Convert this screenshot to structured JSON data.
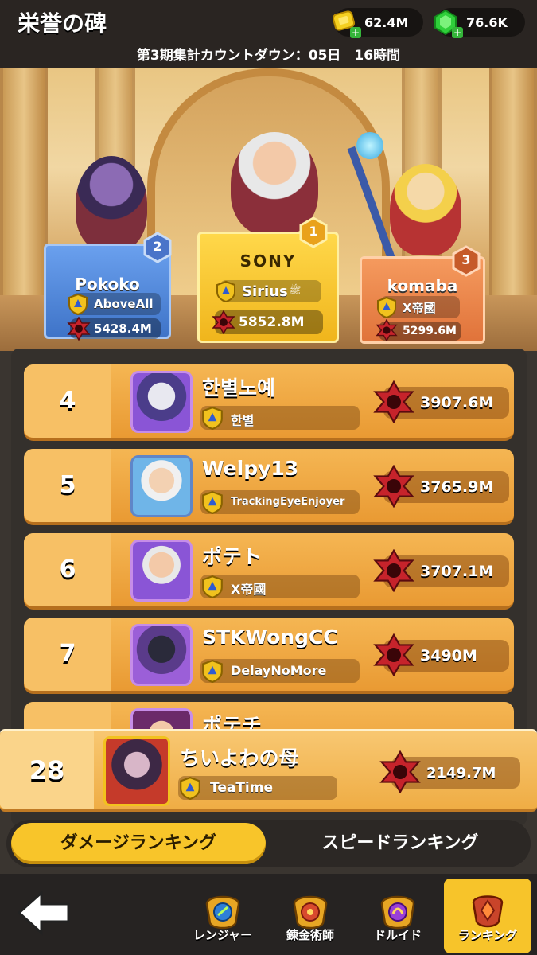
{
  "header": {
    "title": "栄誉の碑",
    "gold": "62.4M",
    "gems": "76.6K"
  },
  "countdown": "第3期集計カウントダウン：05日　16時間",
  "podium": [
    {
      "rank": "2",
      "name": "Pokoko",
      "guild": "AboveAll",
      "damage": "5428.4M",
      "color": "#5b8fe0"
    },
    {
      "rank": "1",
      "name": "Sirius",
      "title_badge": "SONY",
      "guild": "Sirius",
      "guild_extra": "ﷺ",
      "damage": "5852.8M",
      "color": "#f4c43c"
    },
    {
      "rank": "3",
      "name": "komaba",
      "guild": "X帝國",
      "damage": "5299.6M",
      "color": "#ea8a4b"
    }
  ],
  "rows": [
    {
      "rank": "4",
      "name": "한별노예",
      "guild": "한별",
      "damage": "3907.6M"
    },
    {
      "rank": "5",
      "name": "Welpy13",
      "guild": "TrackingEyeEnjoyer",
      "damage": "3765.9M"
    },
    {
      "rank": "6",
      "name": "ポテト",
      "guild": "X帝國",
      "damage": "3707.1M"
    },
    {
      "rank": "7",
      "name": "STKWongCC",
      "guild": "DelayNoMore",
      "damage": "3490M"
    }
  ],
  "partial_row": {
    "name": "ポテチ"
  },
  "self_row": {
    "rank": "28",
    "name": "ちいよわの母",
    "guild": "TeaTime",
    "damage": "2149.7M"
  },
  "tabs": {
    "damage": "ダメージランキング",
    "speed": "スピードランキング"
  },
  "nav": {
    "ranger": "レンジャー",
    "alchemist": "錬金術師",
    "druid": "ドルイド",
    "ranking": "ランキング"
  },
  "colors": {
    "accent": "#f8c52a",
    "row_orange": "#f0a63d",
    "bg_dark": "#2a2522"
  }
}
